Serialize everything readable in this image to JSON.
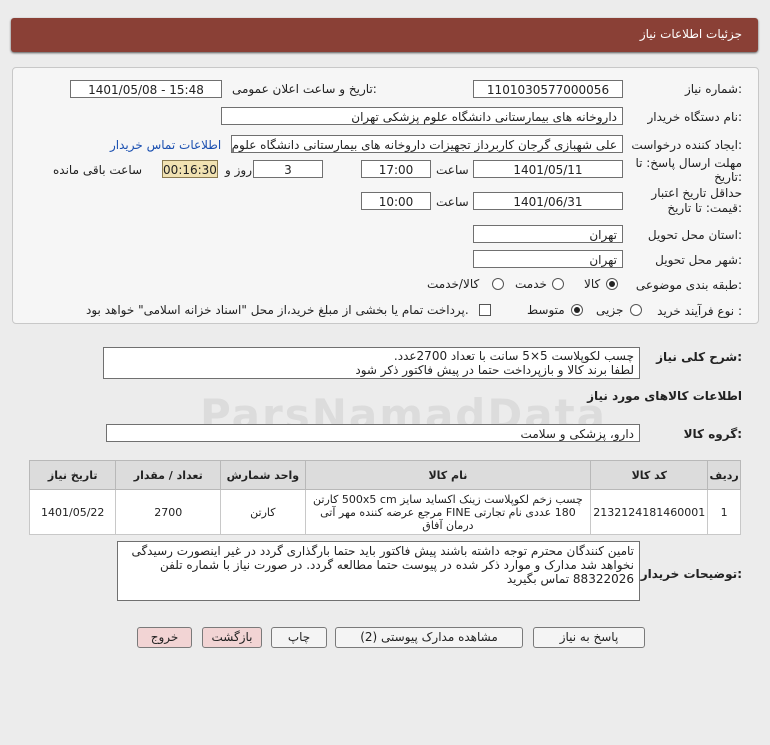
{
  "header": {
    "title": "جزئیات اطلاعات نیاز"
  },
  "form": {
    "need_number_label": "شماره نیاز:",
    "need_number": "1101030577000056",
    "announce_label": "تاریخ و ساعت اعلان عمومی:",
    "announce_value": "1401/05/08 - 15:48",
    "buyer_org_label": "نام دستگاه خریدار:",
    "buyer_org": "داروخانه های بیمارستانی دانشگاه علوم پزشکی تهران",
    "requester_label": "ایجاد کننده درخواست:",
    "requester": "علی شهبازی گرجان کاربرداز تجهیزات داروخانه های بیمارستانی دانشگاه علوم پ",
    "contact_link": "اطلاعات تماس خریدار",
    "deadline_label": "مهلت ارسال پاسخ: تا تاریخ:",
    "deadline_date": "1401/05/11",
    "time_label": "ساعت",
    "deadline_time": "17:00",
    "days_value": "3",
    "days_label": "روز و",
    "remaining_time": "00:16:30",
    "remaining_label": "ساعت باقی مانده",
    "validity_label_1": "حداقل تاریخ اعتبار",
    "validity_label_2": "قیمت: تا تاریخ:",
    "validity_date": "1401/06/31",
    "validity_time": "10:00",
    "province_label": "استان محل تحویل:",
    "province": "تهران",
    "city_label": "شهر محل تحویل:",
    "city": "تهران",
    "category_label": "طبقه بندی موضوعی:",
    "category_options": [
      "کالا",
      "خدمت",
      "کالا/خدمت"
    ],
    "category_selected": "کالا",
    "process_label": "نوع فرآیند خرید :",
    "process_options": [
      "جزیی",
      "متوسط"
    ],
    "process_selected": "متوسط",
    "payment_note": "پرداخت تمام یا بخشی از مبلغ خرید،از محل \"اسناد خزانه اسلامی\" خواهد بود."
  },
  "description": {
    "label": "شرح کلی نیاز:",
    "line1": "چسب لکوپلاست 5×5 سانت با تعداد 2700عدد.",
    "line2": "لطفا برند کالا و بازپرداخت حتما در پیش فاکتور ذکر شود"
  },
  "goods": {
    "section_title": "اطلاعات کالاهای مورد نیاز",
    "group_label": "گروه کالا:",
    "group_value": "دارو، پزشکی و سلامت",
    "columns": [
      "ردیف",
      "کد کالا",
      "نام کالا",
      "واحد شمارش",
      "تعداد / مقدار",
      "تاریخ نیاز"
    ],
    "rows": [
      {
        "index": "1",
        "code": "2132124181460001",
        "name": "چسب زخم لکوپلاست زینک اکساید سایز 500x5 cm کارتن 180 عددی نام تجارتی FINE مرجع عرضه کننده مهر آتی درمان آفاق",
        "unit": "کارتن",
        "qty": "2700",
        "date": "1401/05/22"
      }
    ]
  },
  "buyer_notes": {
    "label": "توضیحات خریدار:",
    "text": "تامین کنندگان محترم توجه داشته باشند پیش فاکتور باید حتما بارگذاری گردد در غیر اینصورت رسیدگی نخواهد شد مدارک و موارد ذکر شده در پیوست حتما مطالعه گردد. در صورت نیاز با شماره تلفن 88322026 تماس بگیرید"
  },
  "watermark": "ParsNamadData",
  "buttons": {
    "respond": "پاسخ به نیاز",
    "attachments": "مشاهده مدارک پیوستی (2)",
    "print": "چاپ",
    "back": "بازگشت",
    "exit": "خروج"
  }
}
